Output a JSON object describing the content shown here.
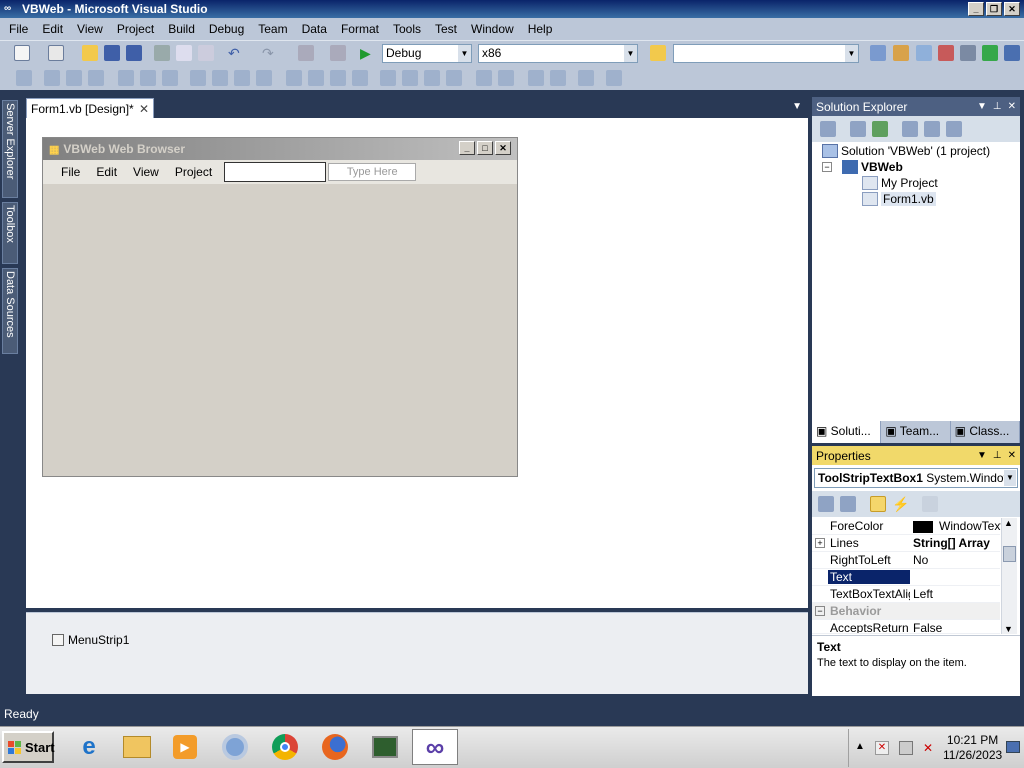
{
  "window": {
    "title": "VBWeb - Microsoft Visual Studio"
  },
  "menu": [
    "File",
    "Edit",
    "View",
    "Project",
    "Build",
    "Debug",
    "Team",
    "Data",
    "Format",
    "Tools",
    "Test",
    "Window",
    "Help"
  ],
  "toolbar": {
    "config": "Debug",
    "platform": "x86",
    "find_value": ""
  },
  "sidebar_tabs": [
    "Server Explorer",
    "Toolbox",
    "Data Sources"
  ],
  "doc_tab": {
    "label": "Form1.vb [Design]*"
  },
  "form": {
    "title": "VBWeb Web Browser",
    "menu": [
      "File",
      "Edit",
      "View",
      "Project"
    ],
    "textbox_value": "",
    "type_here": "Type Here"
  },
  "tray": {
    "component": "MenuStrip1"
  },
  "solution_explorer": {
    "title": "Solution Explorer",
    "solution": "Solution 'VBWeb' (1 project)",
    "project": "VBWeb",
    "items": [
      "My Project",
      "Form1.vb"
    ],
    "tabs": [
      "Soluti...",
      "Team...",
      "Class..."
    ]
  },
  "properties": {
    "title": "Properties",
    "object": "ToolStripTextBox1",
    "object_type": "System.Windov",
    "rows": [
      {
        "name": "ForeColor",
        "value": "WindowText"
      },
      {
        "name": "Lines",
        "value": "String[] Array"
      },
      {
        "name": "RightToLeft",
        "value": "No"
      },
      {
        "name": "Text",
        "value": ""
      },
      {
        "name": "TextBoxTextAlig",
        "value": "Left"
      },
      {
        "name": "Behavior",
        "value": ""
      },
      {
        "name": "AcceptsReturn",
        "value": "False"
      }
    ],
    "desc_title": "Text",
    "desc_text": "The text to display on the item."
  },
  "status": {
    "text": "Ready"
  },
  "taskbar": {
    "start": "Start",
    "time": "10:21 PM",
    "date": "11/26/2023"
  },
  "colors": {
    "vs_bg": "#293955",
    "toolbar": "#bcc7d8",
    "select": "#0a246a"
  }
}
